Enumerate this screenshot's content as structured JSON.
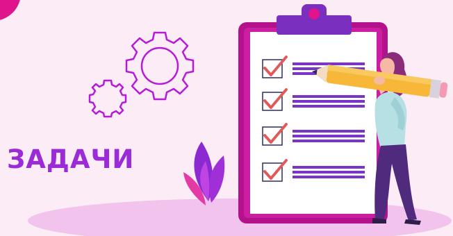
{
  "heading": "ЗАДАЧИ",
  "colors": {
    "background": "#fbecf5",
    "accent_magenta": "#e0148c",
    "accent_purple": "#9b2bd6",
    "ground_ellipse": "#f2c3ec",
    "check_red": "#e05a5a",
    "line_purple": "#7a34c8",
    "pencil_yellow": "#f7b83a"
  },
  "checklist": {
    "items": [
      {
        "checked": true
      },
      {
        "checked": true
      },
      {
        "checked": true
      },
      {
        "checked": true
      }
    ]
  },
  "icons": [
    "gear-icon-large",
    "gear-icon-small",
    "leaf-plant-icon",
    "clipboard-icon",
    "checkmark-icon",
    "pencil-icon",
    "woman-figure"
  ]
}
